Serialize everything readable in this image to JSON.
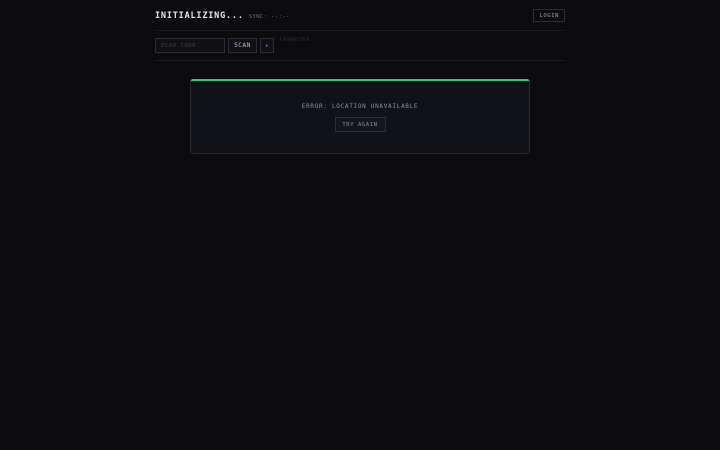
{
  "header": {
    "title": "INITIALIZING...",
    "sync": "SYNC: --:--",
    "login_label": "LOGIN"
  },
  "toolbar": {
    "icao_placeholder": "ICAO CODE",
    "icao_value": "",
    "scan_label": "SCAN",
    "fav_glyph": "▸",
    "favorites_label": "FAVORITES"
  },
  "panel": {
    "error_message": "ERROR: LOCATION UNAVAILABLE",
    "retry_label": "TRY AGAIN",
    "accent_color": "#3bbf7e"
  }
}
